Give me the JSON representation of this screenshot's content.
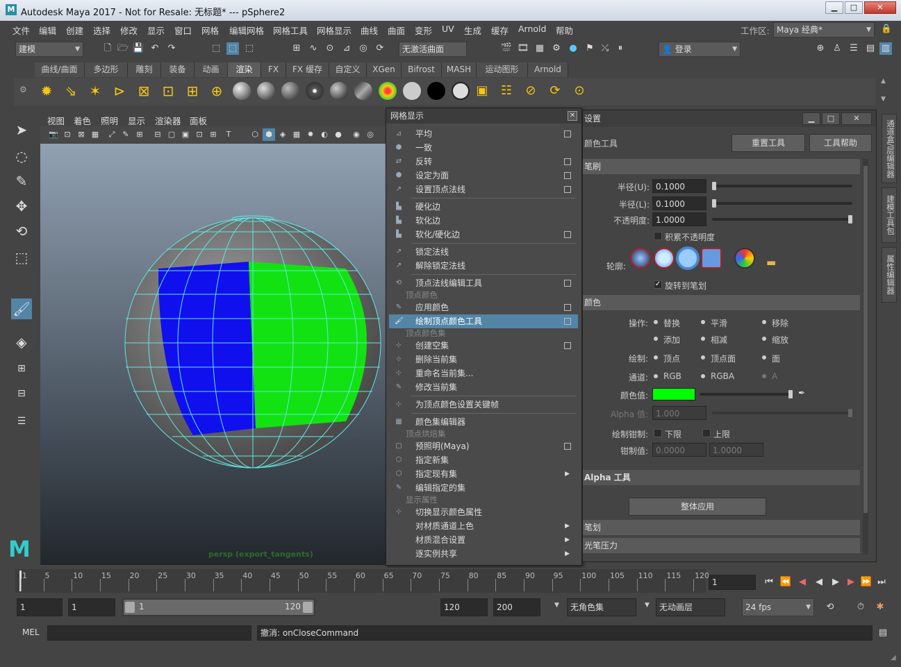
{
  "window": {
    "title": "Autodesk Maya 2017 - Not for Resale: 无标题*   ---   pSphere2",
    "logo": "M",
    "minimize_icon": "minimize-icon",
    "maximize_icon": "maximize-icon",
    "close_icon": "close-icon"
  },
  "menubar": {
    "items": [
      "文件",
      "编辑",
      "创建",
      "选择",
      "修改",
      "显示",
      "窗口",
      "网格",
      "编辑网格",
      "网格工具",
      "网格显示",
      "曲线",
      "曲面",
      "变形",
      "UV",
      "生成",
      "缓存",
      "Arnold",
      "帮助"
    ],
    "workspace_label": "工作区:",
    "workspace_value": "Maya 经典*"
  },
  "toolbar": {
    "mode": "建模",
    "live_surface": "无激活曲面",
    "login": "登录"
  },
  "shelf": {
    "tabs": [
      "曲线/曲面",
      "多边形",
      "雕刻",
      "装备",
      "动画",
      "渲染",
      "FX",
      "FX 缓存",
      "自定义",
      "XGen",
      "Bifrost",
      "MASH",
      "运动图形",
      "Arnold"
    ],
    "active_tab": "渲染"
  },
  "panel": {
    "menu": [
      "视图",
      "着色",
      "照明",
      "显示",
      "渲染器",
      "面板"
    ],
    "camera_label": "persp (export_tangents)"
  },
  "popup": {
    "title": "网格显示",
    "items": [
      {
        "label": "平均",
        "box": true
      },
      {
        "label": "一致",
        "box": false
      },
      {
        "label": "反转",
        "box": true
      },
      {
        "label": "设定为面",
        "box": true
      },
      {
        "label": "设置顶点法线",
        "box": true
      },
      {
        "label": "硬化边",
        "box": false
      },
      {
        "label": "软化边",
        "box": false
      },
      {
        "label": "软化/硬化边",
        "box": true
      },
      {
        "label": "锁定法线",
        "box": false
      },
      {
        "label": "解除锁定法线",
        "box": false
      },
      {
        "label": "顶点法线编辑工具",
        "box": true
      },
      {
        "label": "应用颜色",
        "box": true
      },
      {
        "label": "绘制顶点颜色工具",
        "box": true
      },
      {
        "label": "创建空集",
        "box": true
      },
      {
        "label": "删除当前集",
        "box": false
      },
      {
        "label": "重命名当前集...",
        "box": false
      },
      {
        "label": "修改当前集",
        "box": false
      },
      {
        "label": "为顶点颜色设置关键帧",
        "box": false
      },
      {
        "label": "颜色集编辑器",
        "box": false
      },
      {
        "label": "预照明(Maya)",
        "box": true
      },
      {
        "label": "指定新集",
        "box": false
      },
      {
        "label": "指定现有集",
        "box": false
      },
      {
        "label": "编辑指定的集",
        "box": false
      },
      {
        "label": "切换显示颜色属性",
        "box": false
      },
      {
        "label": "对材质通道上色",
        "box": false
      },
      {
        "label": "材质混合设置",
        "box": false
      },
      {
        "label": "逐实例共享",
        "box": false
      }
    ],
    "sections": [
      "顶点颜色",
      "顶点颜色集",
      "顶点烘焙集",
      "显示属性"
    ],
    "highlighted": "绘制顶点颜色工具"
  },
  "tool_settings": {
    "title": "设置",
    "tool_name": "颜色工具",
    "reset_button": "重置工具",
    "help_button": "工具帮助",
    "section_brush": "笔刷",
    "radius_u_label": "半径(U):",
    "radius_u": "0.1000",
    "radius_l_label": "半径(L):",
    "radius_l": "0.1000",
    "opacity_label": "不透明度:",
    "opacity": "1.0000",
    "accumulate_label": "积累不透明度",
    "profile_label": "轮廓:",
    "rotate_label": "旋转到笔划",
    "section_color": "颜色",
    "operation_label": "操作:",
    "ops": [
      "替换",
      "平滑",
      "移除",
      "添加",
      "相减",
      "缩放"
    ],
    "paint_label": "绘制:",
    "paint_opts": [
      "顶点",
      "顶点面",
      "面"
    ],
    "channel_label": "通道:",
    "channel_opts": [
      "RGB",
      "RGBA",
      "A"
    ],
    "color_value_label": "颜色值:",
    "color_value": "#00ff00",
    "alpha_label": "Alpha 值:",
    "alpha_value": "1.000",
    "clamp_label": "绘制钳制:",
    "clamp_lower": "下限",
    "clamp_upper": "上限",
    "clamp_values_label": "钳制值:",
    "clamp_min": "0.0000",
    "clamp_max": "1.0000",
    "section_alpha": "Alpha 工具",
    "apply_all": "整体应用",
    "section_stroke": "笔划",
    "section_pressure": "光笔压力"
  },
  "timeline": {
    "ticks": [
      "1",
      "5",
      "10",
      "15",
      "20",
      "25",
      "30",
      "35",
      "40",
      "45",
      "50",
      "55",
      "60",
      "65",
      "70",
      "75",
      "80",
      "85",
      "90",
      "95",
      "100",
      "105",
      "110",
      "115",
      "120"
    ],
    "current_frame": "1"
  },
  "range": {
    "start": "1",
    "playback_start": "1",
    "range_start": "1",
    "range_end": "120",
    "playback_end": "120",
    "end": "200",
    "char_set": "无角色集",
    "anim_layer": "无动画层",
    "fps": "24 fps"
  },
  "command": {
    "lang": "MEL",
    "result": "撤消: onCloseCommand"
  },
  "sidebar": {
    "tabs": [
      "通道盒/层编辑器",
      "建模工具包",
      "属性编辑器"
    ]
  }
}
